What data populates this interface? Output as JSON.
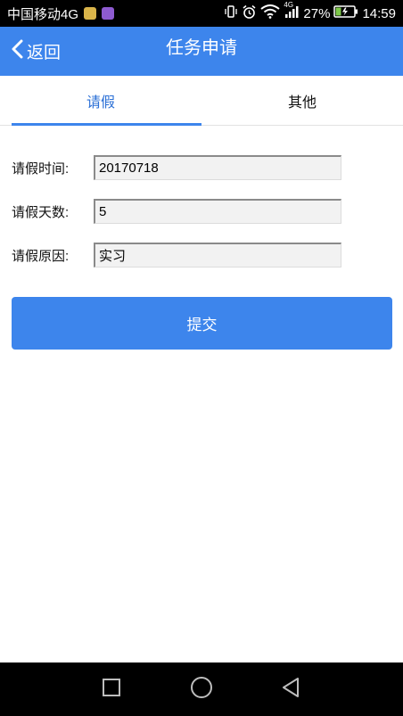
{
  "status_bar": {
    "carrier": "中国移动4G",
    "network_small": "4G",
    "battery_percent": "27%",
    "time": "14:59"
  },
  "header": {
    "back_label": "返回",
    "title": "任务申请",
    "color": "#3d85ec"
  },
  "tabs": [
    {
      "label": "请假",
      "active": true
    },
    {
      "label": "其他",
      "active": false
    }
  ],
  "form": {
    "fields": [
      {
        "label": "请假时间:",
        "value": "20170718"
      },
      {
        "label": "请假天数:",
        "value": "5"
      },
      {
        "label": "请假原因:",
        "value": "实习"
      }
    ],
    "submit_label": "提交"
  },
  "icons": {
    "vibrate": "vibrate-icon",
    "alarm": "alarm-icon",
    "wifi": "wifi-icon",
    "signal": "signal-icon",
    "battery": "battery-charging-icon",
    "back": "chevron-left-icon",
    "nav_recent": "square-icon",
    "nav_home": "circle-icon",
    "nav_back": "triangle-back-icon"
  }
}
